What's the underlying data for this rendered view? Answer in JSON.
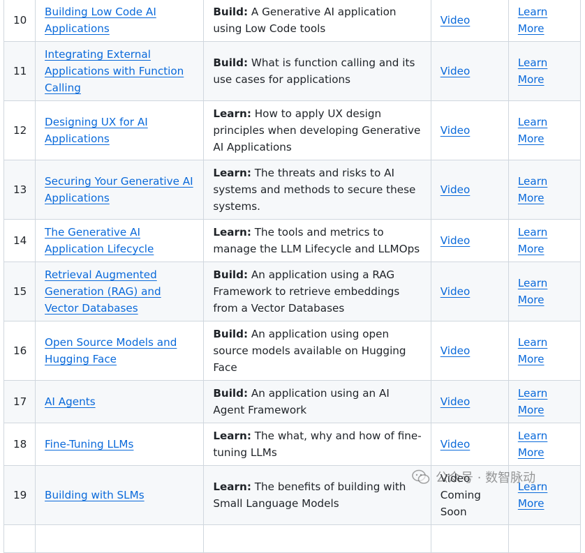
{
  "rows": [
    {
      "num": "10",
      "lesson": "Building Low Code AI Applications",
      "tag": "Build:",
      "desc": " A Generative AI application using Low Code tools",
      "video": "Video",
      "more": "Learn More"
    },
    {
      "num": "11",
      "lesson": "Integrating External Applications with Function Calling",
      "tag": "Build:",
      "desc": " What is function calling and its use cases for applications",
      "video": "Video",
      "more": "Learn More"
    },
    {
      "num": "12",
      "lesson": "Designing UX for AI Applications",
      "tag": "Learn:",
      "desc": " How to apply UX design principles when developing Generative AI Applications",
      "video": "Video",
      "more": "Learn More"
    },
    {
      "num": "13",
      "lesson": "Securing Your Generative AI Applications",
      "tag": "Learn:",
      "desc": " The threats and risks to AI systems and methods to secure these systems.",
      "video": "Video",
      "more": "Learn More"
    },
    {
      "num": "14",
      "lesson": "The Generative AI Application Lifecycle",
      "tag": "Learn:",
      "desc": " The tools and metrics to manage the LLM Lifecycle and LLMOps",
      "video": "Video",
      "more": "Learn More"
    },
    {
      "num": "15",
      "lesson": "Retrieval Augmented Generation (RAG) and Vector Databases",
      "tag": "Build:",
      "desc": " An application using a RAG Framework to retrieve embeddings from a Vector Databases",
      "video": "Video",
      "more": "Learn More"
    },
    {
      "num": "16",
      "lesson": "Open Source Models and Hugging Face",
      "tag": "Build:",
      "desc": " An application using open source models available on Hugging Face",
      "video": "Video",
      "more": "Learn More"
    },
    {
      "num": "17",
      "lesson": "AI Agents",
      "tag": "Build:",
      "desc": " An application using an AI Agent Framework",
      "video": "Video",
      "more": "Learn More"
    },
    {
      "num": "18",
      "lesson": "Fine-Tuning LLMs",
      "tag": "Learn:",
      "desc": " The what, why and how of fine-tuning LLMs",
      "video": "Video",
      "more": "Learn More"
    },
    {
      "num": "19",
      "lesson": "Building with SLMs",
      "tag": "Learn:",
      "desc": " The benefits of building with Small Language Models",
      "video_plain": "Video Coming Soon",
      "more": "Learn More"
    }
  ],
  "watermark": {
    "text": "公众号 · 数智脉动",
    "icon": "wechat-icon"
  }
}
